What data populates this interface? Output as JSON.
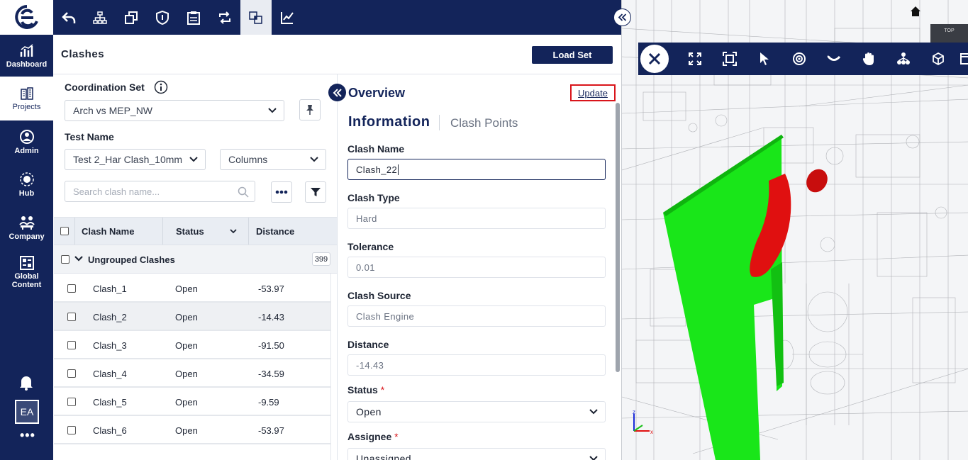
{
  "nav": {
    "items": [
      {
        "label": "Dashboard"
      },
      {
        "label": "Projects"
      },
      {
        "label": "Admin"
      },
      {
        "label": "Hub"
      },
      {
        "label": "Company"
      },
      {
        "label": "Global Content"
      }
    ],
    "avatar": "EA",
    "more": "•••"
  },
  "toolbar": {
    "icons": [
      "undo-icon",
      "hierarchy-icon",
      "copy-icon",
      "shield-icon",
      "report-icon",
      "sync-icon",
      "clash-detection-icon",
      "chart-check-icon"
    ]
  },
  "header": {
    "title": "Clashes",
    "load_set": "Load Set"
  },
  "left": {
    "coordination_label": "Coordination Set",
    "coordination_value": "Arch vs MEP_NW",
    "test_label": "Test Name",
    "test_value": "Test 2_Har Clash_10mm",
    "columns_value": "Columns",
    "search_placeholder": "Search clash name...",
    "columns": {
      "name": "Clash Name",
      "status": "Status",
      "distance": "Distance"
    },
    "group": {
      "label": "Ungrouped Clashes",
      "count": "399"
    },
    "rows": [
      {
        "name": "Clash_1",
        "status": "Open",
        "distance": "-53.97"
      },
      {
        "name": "Clash_2",
        "status": "Open",
        "distance": "-14.43"
      },
      {
        "name": "Clash_3",
        "status": "Open",
        "distance": "-91.50"
      },
      {
        "name": "Clash_4",
        "status": "Open",
        "distance": "-34.59"
      },
      {
        "name": "Clash_5",
        "status": "Open",
        "distance": "-9.59"
      },
      {
        "name": "Clash_6",
        "status": "Open",
        "distance": "-53.97"
      }
    ]
  },
  "detail": {
    "overview": "Overview",
    "update": "Update",
    "tab_info": "Information",
    "tab_points": "Clash Points",
    "clash_name_label": "Clash Name",
    "clash_name_value": "Clash_22",
    "clash_type_label": "Clash Type",
    "clash_type_value": "Hard",
    "tolerance_label": "Tolerance",
    "tolerance_value": "0.01",
    "source_label": "Clash Source",
    "source_value": "Clash Engine",
    "distance_label": "Distance",
    "distance_value": "-14.43",
    "status_label": "Status",
    "status_value": "Open",
    "assignee_label": "Assignee",
    "assignee_value": "Unassigned",
    "required_mark": "*"
  },
  "viewer": {
    "cube_label": "TOP",
    "axis_x": "x",
    "axis_z": "z",
    "colors": {
      "wall": "#19e619",
      "pipe": "#e01010"
    }
  }
}
